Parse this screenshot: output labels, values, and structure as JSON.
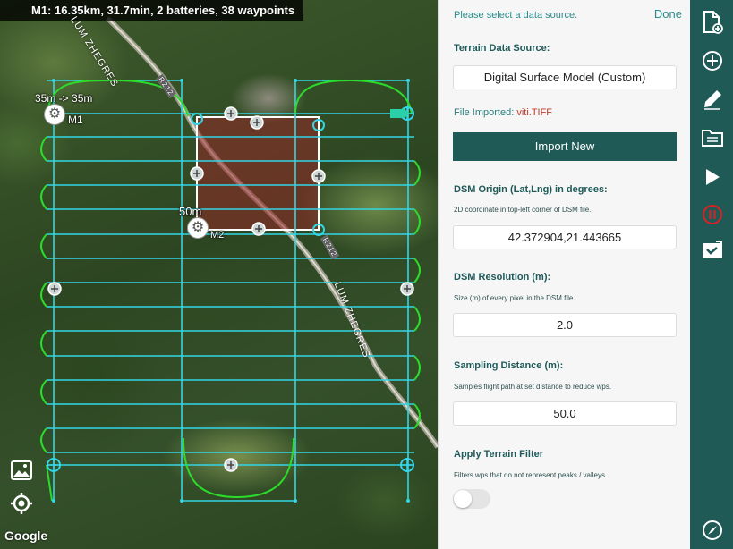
{
  "map": {
    "info_bar": "M1: 16.35km, 31.7min, 2 batteries, 38 waypoints",
    "m1_label": "M1",
    "m1_altitude": "35m -> 35m",
    "m2_label": "M2",
    "m2_altitude": "50m",
    "road_label_top": "LUM ZHEGRES",
    "road_label_bottom": "LUM ZHEGRES",
    "route_tag_1": "R212",
    "route_tag_2": "R212",
    "attribution": "Google",
    "icons": [
      "gallery-icon",
      "locate-icon"
    ]
  },
  "panel": {
    "hint": "Please select a data source.",
    "done_label": "Done",
    "terrain_source": {
      "title": "Terrain Data Source:",
      "value": "Digital Surface Model (Custom)"
    },
    "file_imported": {
      "label": "File Imported:",
      "filename": "viti.TIFF"
    },
    "import_button": "Import New",
    "dsm_origin": {
      "title": "DSM Origin (Lat,Lng) in degrees:",
      "description": "2D coordinate in top-left corner of DSM file.",
      "value": "42.372904,21.443665"
    },
    "dsm_resolution": {
      "title": "DSM Resolution (m):",
      "description": "Size (m) of every pixel in the DSM file.",
      "value": "2.0"
    },
    "sampling_distance": {
      "title": "Sampling Distance (m):",
      "description": "Samples flight path at set distance to reduce wps.",
      "value": "50.0"
    },
    "terrain_filter": {
      "title": "Apply Terrain Filter",
      "description": "Filters wps that do not represent peaks / valleys.",
      "enabled": false
    }
  },
  "sidebar": {
    "icons": [
      "new-file-icon",
      "add-icon",
      "edit-icon",
      "folder-icon",
      "play-icon",
      "stop-record-icon",
      "video-camera-icon",
      "compass-icon"
    ]
  },
  "colors": {
    "accent": "#1f5a57",
    "accent_text": "#2a8d8c",
    "flight_line": "#33d6e6",
    "turn_line": "#2bdc2b",
    "filename": "#c0392b",
    "record_red": "#e02020"
  }
}
